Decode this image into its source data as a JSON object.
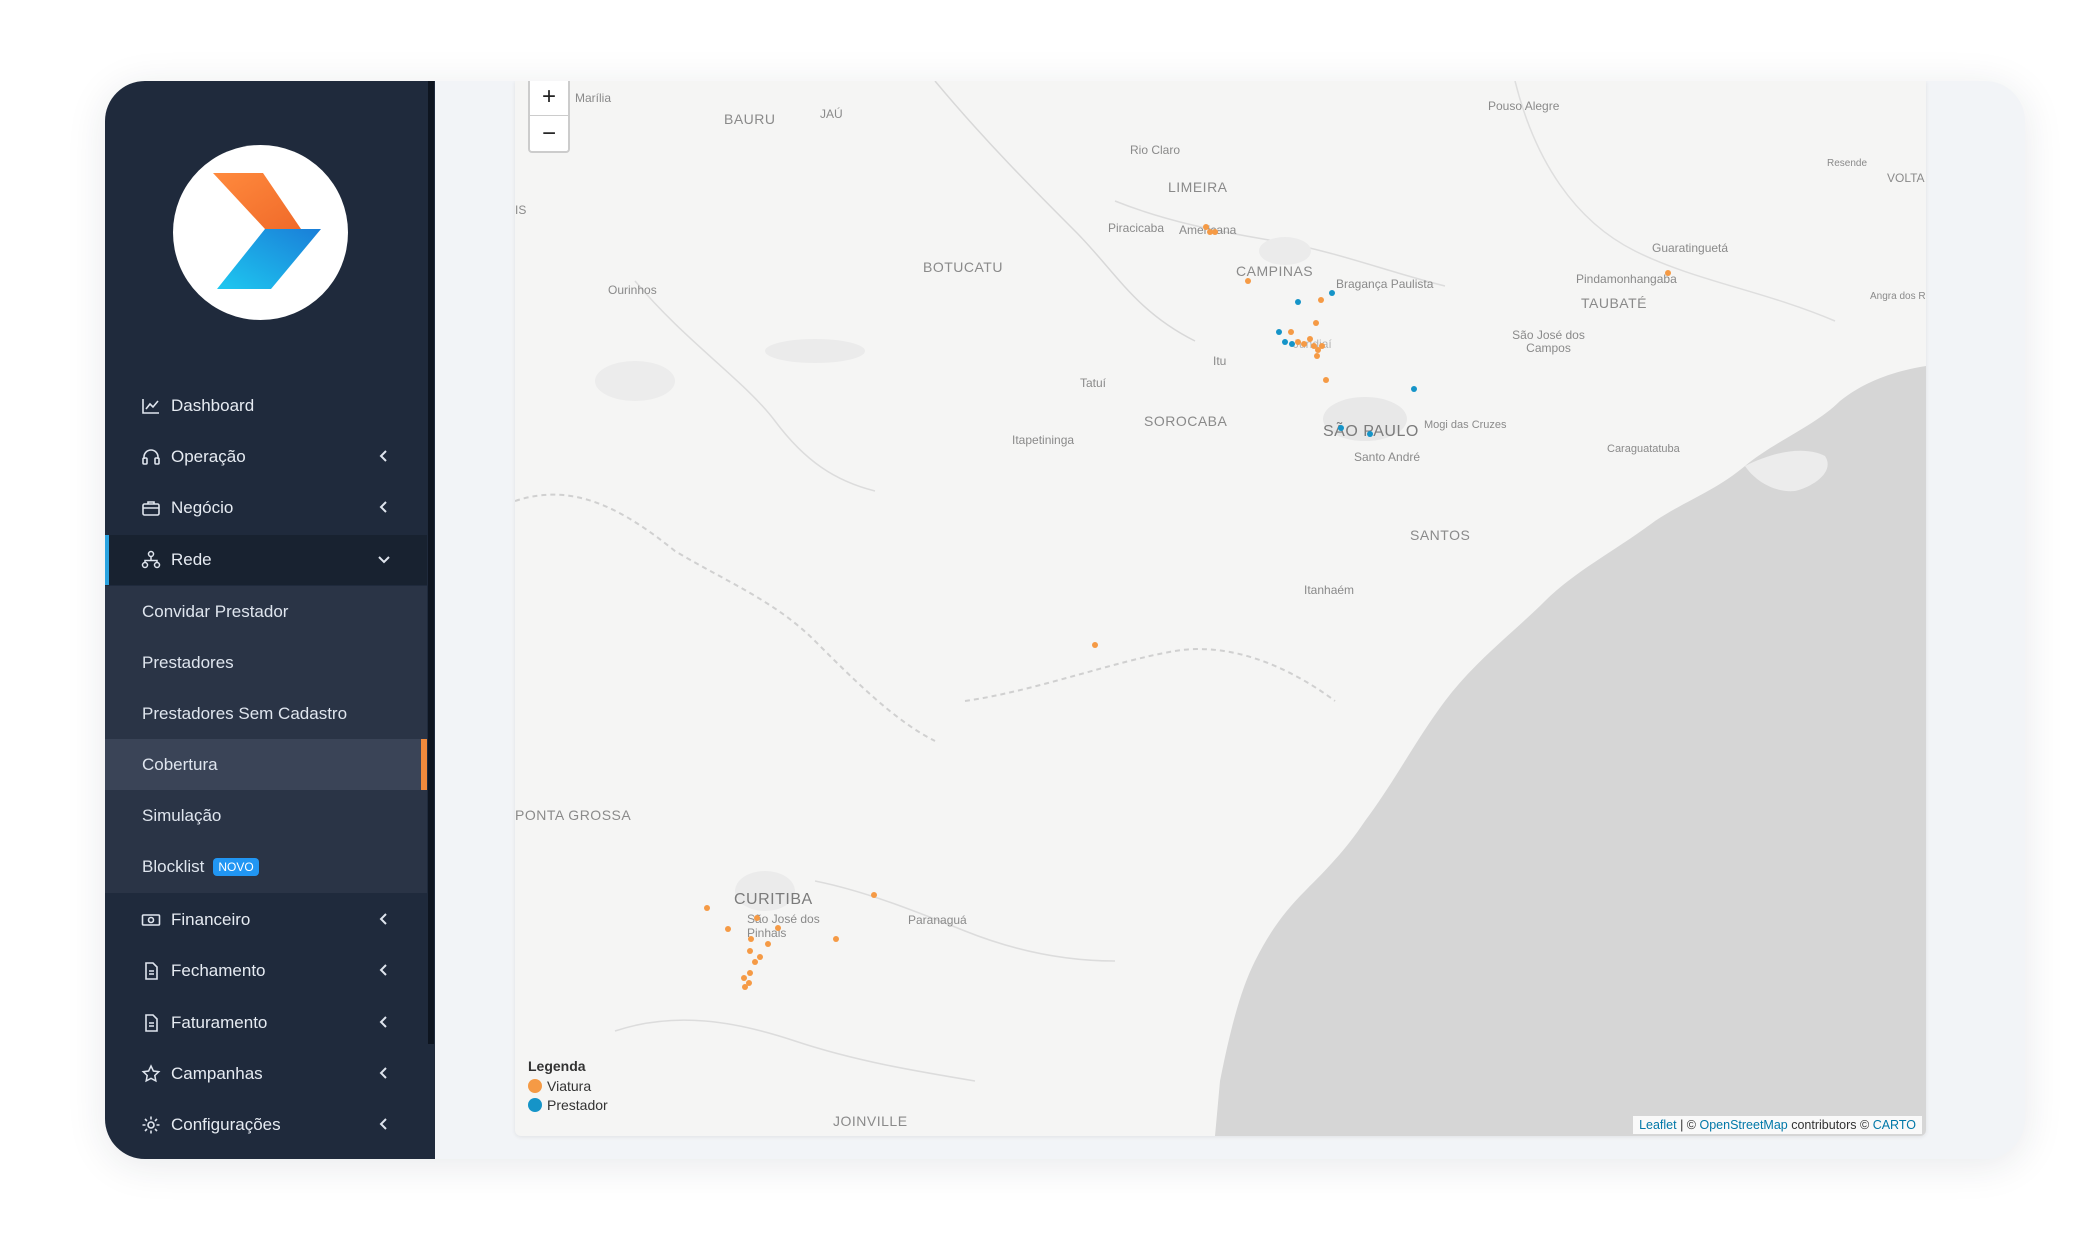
{
  "sidebar": {
    "menu": [
      {
        "label": "Dashboard",
        "icon": "chart-line-icon"
      },
      {
        "label": "Operação",
        "icon": "headset-icon"
      },
      {
        "label": "Negócio",
        "icon": "briefcase-icon"
      },
      {
        "label": "Rede",
        "icon": "network-icon"
      },
      {
        "label": "Financeiro",
        "icon": "money-icon"
      },
      {
        "label": "Fechamento",
        "icon": "document-icon"
      },
      {
        "label": "Faturamento",
        "icon": "document-icon"
      },
      {
        "label": "Campanhas",
        "icon": "star-icon"
      },
      {
        "label": "Configurações",
        "icon": "gear-icon"
      }
    ],
    "submenu": [
      {
        "label": "Convidar Prestador"
      },
      {
        "label": "Prestadores"
      },
      {
        "label": "Prestadores Sem Cadastro"
      },
      {
        "label": "Cobertura"
      },
      {
        "label": "Simulação"
      },
      {
        "label": "Blocklist",
        "badge": "NOVO"
      }
    ],
    "active_item": "Cobertura",
    "colors": {
      "background": "#1f2a3c",
      "active_accent": "#f18a3c",
      "open_accent": "#2aa3e0"
    }
  },
  "map": {
    "zoom_in": "+",
    "zoom_out": "−",
    "labels": {
      "marilia": "Marília",
      "bauru": "BAURU",
      "jau": "JAÚ",
      "pouso_alegre": "Pouso Alegre",
      "resende": "Resende",
      "volta": "VOLTA",
      "rio_claro": "Rio Claro",
      "limeira": "LIMEIRA",
      "piracicaba": "Piracicaba",
      "americana": "Americana",
      "campinas": "CAMPINAS",
      "braganca": "Bragança Paulista",
      "guaratingueta": "Guaratinguetá",
      "pindamonhangaba": "Pindamonhangaba",
      "taubate": "TAUBATÉ",
      "angra": "Angra dos Re",
      "botucatu": "BOTUCATU",
      "ourinhos": "Ourinhos",
      "sjcampos": "São José dos Campos",
      "jundiai": "Jundiaí",
      "itu": "Itu",
      "tatui": "Tatuí",
      "sorocaba": "SOROCABA",
      "itapetininga": "Itapetininga",
      "sao_paulo": "SÃO PAULO",
      "mogi": "Mogi das Cruzes",
      "santo_andre": "Santo André",
      "caraguatatuba": "Caraguatatuba",
      "santos": "SANTOS",
      "itanhaem": "Itanhaém",
      "ponta_grossa": "PONTA GROSSA",
      "curitiba": "CURITIBA",
      "sjpinhais": "São José dos Pinhais",
      "paranagua": "Paranaguá",
      "joinville": "JOINVILLE",
      "is": "IS"
    },
    "legend": {
      "title": "Legenda",
      "items": [
        {
          "label": "Viatura",
          "color": "#f59a45"
        },
        {
          "label": "Prestador",
          "color": "#1594c8"
        }
      ]
    },
    "attribution": {
      "leaflet": "Leaflet",
      "sep": " | © ",
      "osm": "OpenStreetMap",
      "contributors": " contributors © ",
      "carto": "CARTO"
    }
  }
}
